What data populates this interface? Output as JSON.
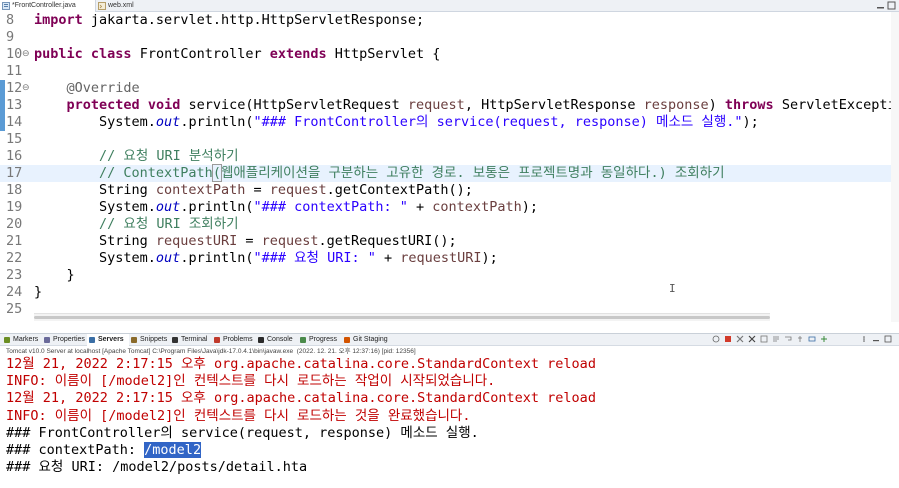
{
  "editor_tabs": [
    {
      "label": "*FrontController.java",
      "active": true
    },
    {
      "label": "web.xml",
      "active": false
    }
  ],
  "code_lines": [
    {
      "num": "8",
      "segments": [
        {
          "t": "import",
          "c": "kw"
        },
        {
          "t": " jakarta.servlet.http.HttpServletResponse;",
          "c": ""
        }
      ]
    },
    {
      "num": "9",
      "segments": []
    },
    {
      "num": "10",
      "segments": [
        {
          "t": "public",
          "c": "kw"
        },
        {
          "t": " ",
          "c": ""
        },
        {
          "t": "class",
          "c": "kw"
        },
        {
          "t": " FrontController ",
          "c": ""
        },
        {
          "t": "extends",
          "c": "kw"
        },
        {
          "t": " HttpServlet {",
          "c": ""
        }
      ]
    },
    {
      "num": "11",
      "segments": []
    },
    {
      "num": "12",
      "segments": [
        {
          "t": "    @Override",
          "c": "ann"
        }
      ]
    },
    {
      "num": "13",
      "segments": [
        {
          "t": "    ",
          "c": ""
        },
        {
          "t": "protected",
          "c": "kw"
        },
        {
          "t": " ",
          "c": ""
        },
        {
          "t": "void",
          "c": "kw"
        },
        {
          "t": " service(HttpServletRequest ",
          "c": ""
        },
        {
          "t": "request",
          "c": "var"
        },
        {
          "t": ", HttpServletResponse ",
          "c": ""
        },
        {
          "t": "response",
          "c": "var"
        },
        {
          "t": ") ",
          "c": ""
        },
        {
          "t": "throws",
          "c": "kw"
        },
        {
          "t": " ServletException",
          "c": ""
        }
      ]
    },
    {
      "num": "14",
      "segments": [
        {
          "t": "        System.",
          "c": ""
        },
        {
          "t": "out",
          "c": "fld"
        },
        {
          "t": ".println(",
          "c": ""
        },
        {
          "t": "\"### FrontController의 service(request, response) 메소드 실행.\"",
          "c": "str"
        },
        {
          "t": ");",
          "c": ""
        }
      ]
    },
    {
      "num": "15",
      "segments": []
    },
    {
      "num": "16",
      "segments": [
        {
          "t": "        // 요청 URI 분석하기",
          "c": "cmt"
        }
      ]
    },
    {
      "num": "17",
      "segments": [
        {
          "t": "        // ContextPath",
          "c": "cmt"
        },
        {
          "t": "(",
          "c": "cmt sel"
        },
        {
          "t": "웹애플리케이션을 구분하는 고유한 경로. 보통은 프로젝트명과 동일하다.) 조회하기",
          "c": "cmt"
        }
      ]
    },
    {
      "num": "18",
      "segments": [
        {
          "t": "        String ",
          "c": ""
        },
        {
          "t": "contextPath",
          "c": "var"
        },
        {
          "t": " = ",
          "c": ""
        },
        {
          "t": "request",
          "c": "var"
        },
        {
          "t": ".getContextPath();",
          "c": ""
        }
      ]
    },
    {
      "num": "19",
      "segments": [
        {
          "t": "        System.",
          "c": ""
        },
        {
          "t": "out",
          "c": "fld"
        },
        {
          "t": ".println(",
          "c": ""
        },
        {
          "t": "\"### contextPath: \"",
          "c": "str"
        },
        {
          "t": " + ",
          "c": ""
        },
        {
          "t": "contextPath",
          "c": "var"
        },
        {
          "t": ");",
          "c": ""
        }
      ]
    },
    {
      "num": "20",
      "segments": [
        {
          "t": "        // 요청 URI 조회하기",
          "c": "cmt"
        }
      ]
    },
    {
      "num": "21",
      "segments": [
        {
          "t": "        String ",
          "c": ""
        },
        {
          "t": "requestURI",
          "c": "var"
        },
        {
          "t": " = ",
          "c": ""
        },
        {
          "t": "request",
          "c": "var"
        },
        {
          "t": ".getRequestURI();",
          "c": ""
        }
      ]
    },
    {
      "num": "22",
      "segments": [
        {
          "t": "        System.",
          "c": ""
        },
        {
          "t": "out",
          "c": "fld"
        },
        {
          "t": ".println(",
          "c": ""
        },
        {
          "t": "\"### 요청 URI: \"",
          "c": "str"
        },
        {
          "t": " + ",
          "c": ""
        },
        {
          "t": "requestURI",
          "c": "var"
        },
        {
          "t": ");",
          "c": ""
        }
      ]
    },
    {
      "num": "23",
      "segments": [
        {
          "t": "    }",
          "c": ""
        }
      ]
    },
    {
      "num": "24",
      "segments": [
        {
          "t": "}",
          "c": ""
        }
      ]
    },
    {
      "num": "25",
      "segments": []
    }
  ],
  "current_line": "17",
  "fold_markers": {
    "10": "⊖",
    "12": "⊖"
  },
  "view_tabs": [
    {
      "label": "Markers",
      "icon": "markers-icon"
    },
    {
      "label": "Properties",
      "icon": "properties-icon"
    },
    {
      "label": "Servers",
      "icon": "servers-icon",
      "active": true
    },
    {
      "label": "Snippets",
      "icon": "snippets-icon"
    },
    {
      "label": "Terminal",
      "icon": "terminal-icon"
    },
    {
      "label": "Problems",
      "icon": "problems-icon"
    },
    {
      "label": "Console",
      "icon": "console-icon"
    },
    {
      "label": "Progress",
      "icon": "progress-icon"
    },
    {
      "label": "Git Staging",
      "icon": "git-staging-icon"
    }
  ],
  "server_status": "Tomcat v10.0 Server at localhost [Apache Tomcat] C:\\Program Files\\Java\\jdk-17.0.4.1\\bin\\javaw.exe  (2022. 12. 21. 오후 12:37:16) [pid: 12356]",
  "console_lines": [
    {
      "text": "12월 21, 2022 2:17:15 오후 org.apache.catalina.core.StandardContext reload",
      "color": "red"
    },
    {
      "text": "INFO: 이름이 [/model2]인 컨텍스트를 다시 로드하는 작업이 시작되었습니다.",
      "color": "red"
    },
    {
      "text": "12월 21, 2022 2:17:15 오후 org.apache.catalina.core.StandardContext reload",
      "color": "red"
    },
    {
      "text": "INFO: 이름이 [/model2]인 컨텍스트를 다시 로드하는 것을 완료했습니다.",
      "color": "red"
    },
    {
      "text": "### FrontController의 service(request, response) 메소드 실행.",
      "color": "black"
    },
    {
      "text": "### contextPath: ",
      "selected": "/model2",
      "color": "black"
    },
    {
      "text": "### 요청 URI: /model2/posts/detail.hta",
      "color": "black"
    }
  ]
}
